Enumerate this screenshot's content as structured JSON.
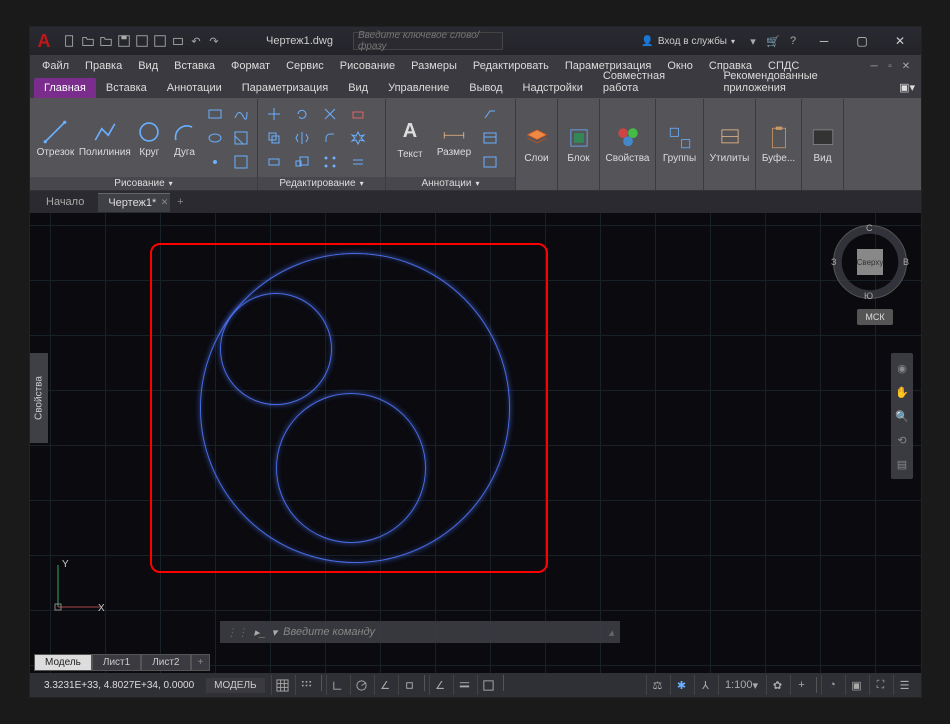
{
  "title_bar": {
    "document_title": "Чертеж1.dwg",
    "search_placeholder": "Введите ключевое слово/фразу",
    "login_label": "Вход в службы"
  },
  "menu": {
    "items": [
      "Файл",
      "Правка",
      "Вид",
      "Вставка",
      "Формат",
      "Сервис",
      "Рисование",
      "Размеры",
      "Редактировать",
      "Параметризация",
      "Окно",
      "Справка",
      "СПДС"
    ]
  },
  "ribbon_tabs": [
    "Главная",
    "Вставка",
    "Аннотации",
    "Параметризация",
    "Вид",
    "Управление",
    "Вывод",
    "Надстройки",
    "Совместная работа",
    "Рекомендованные приложения"
  ],
  "ribbon": {
    "active_tab_index": 0,
    "panels": {
      "draw": {
        "title": "Рисование",
        "line": "Отрезок",
        "polyline": "Полилиния",
        "circle": "Круг",
        "arc": "Дуга"
      },
      "modify": {
        "title": "Редактирование"
      },
      "annotation": {
        "title": "Аннотации",
        "text": "Текст",
        "dimension": "Размер"
      },
      "layers": {
        "label": "Слои"
      },
      "block": {
        "label": "Блок"
      },
      "properties": {
        "label": "Свойства"
      },
      "groups": {
        "label": "Группы"
      },
      "utilities": {
        "label": "Утилиты"
      },
      "clipboard": {
        "label": "Буфе..."
      },
      "view": {
        "label": "Вид"
      }
    }
  },
  "doc_tabs": {
    "start": "Начало",
    "active": "Чертеж1*"
  },
  "canvas": {
    "properties_label": "Свойства",
    "viewcube": {
      "face": "Сверху",
      "n": "С",
      "s": "Ю",
      "e": "В",
      "w": "З"
    },
    "wcs": "МСК",
    "ucs_y": "Y",
    "ucs_x": "X",
    "cmd_placeholder": "Введите команду"
  },
  "layout_tabs": [
    "Модель",
    "Лист1",
    "Лист2"
  ],
  "status": {
    "coords": "3.3231E+33, 4.8027E+34, 0.0000",
    "model": "МОДЕЛЬ",
    "scale": "1:100"
  },
  "colors": {
    "accent": "#7b2d8e",
    "circle": "#5878ff",
    "red": "#ff0000"
  }
}
